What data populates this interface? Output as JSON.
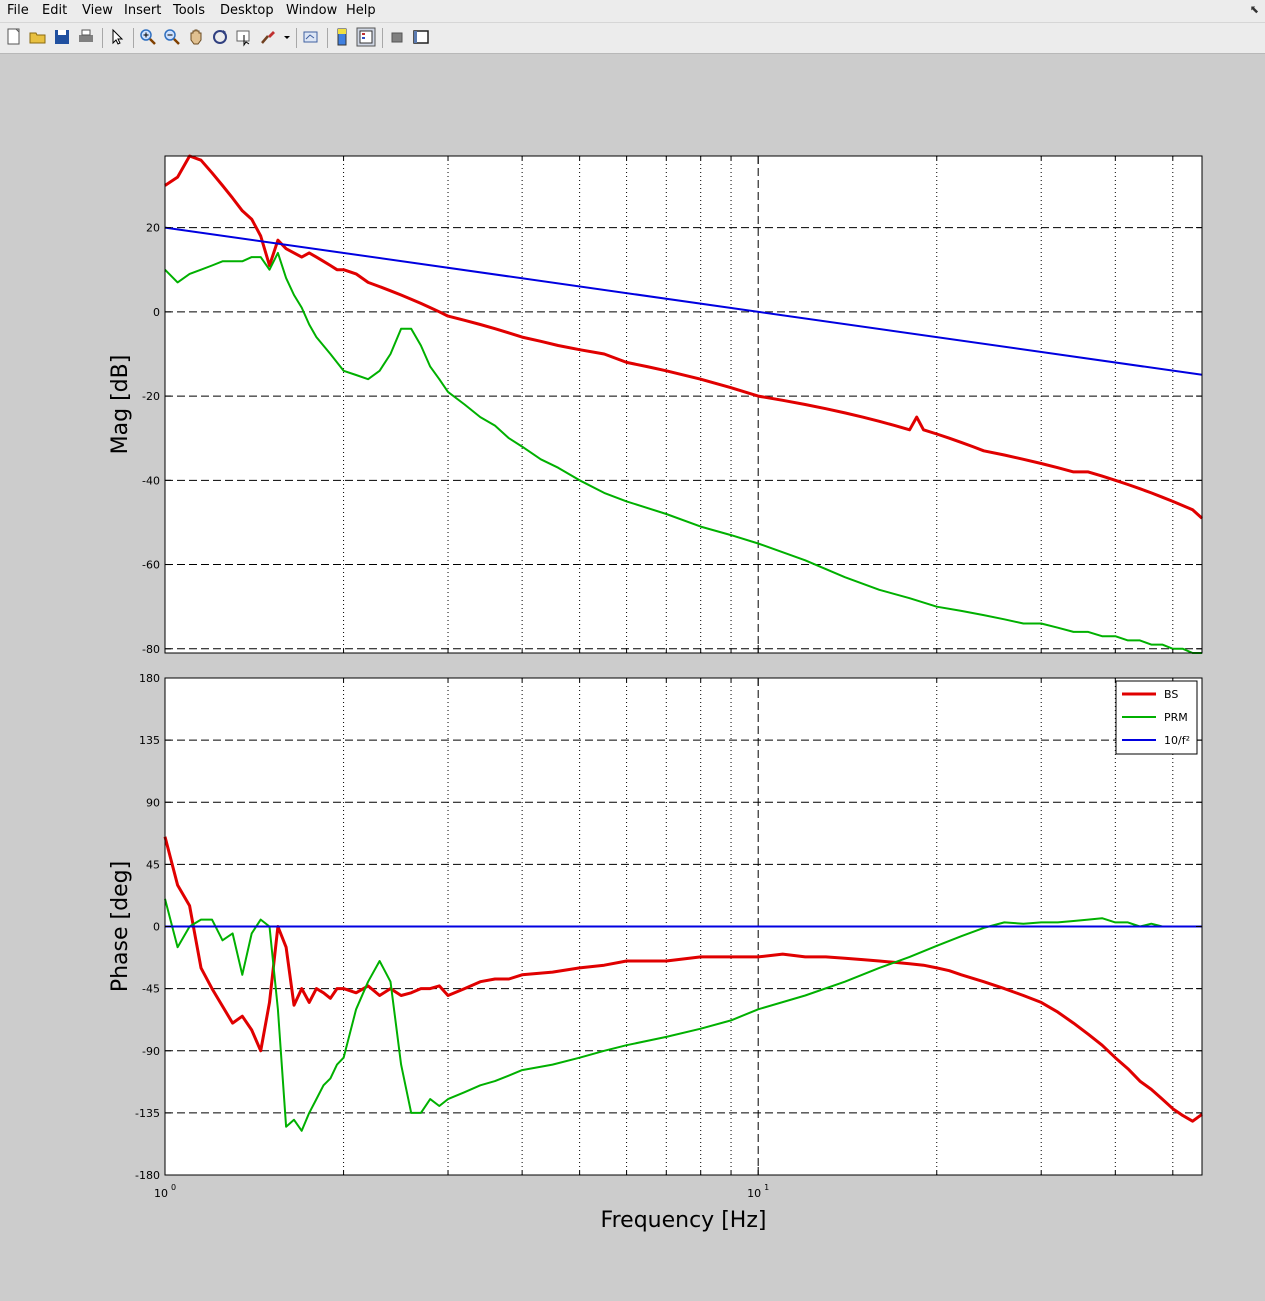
{
  "menu": [
    "File",
    "Edit",
    "View",
    "Insert",
    "Tools",
    "Desktop",
    "Window",
    "Help"
  ],
  "toolbar": [
    {
      "name": "new-figure-icon",
      "color": "#ffffff"
    },
    {
      "name": "open-file-icon",
      "color": "#e8c040"
    },
    {
      "name": "save-icon",
      "color": "#2050a0"
    },
    {
      "name": "print-icon",
      "color": "#808080"
    },
    {
      "sep": true
    },
    {
      "name": "select-arrow-icon",
      "color": "#000000"
    },
    {
      "sep": true
    },
    {
      "name": "zoom-in-icon",
      "color": "#3070c0"
    },
    {
      "name": "zoom-out-icon",
      "color": "#3070c0"
    },
    {
      "name": "pan-hand-icon",
      "color": "#e0c090"
    },
    {
      "name": "rotate-3d-icon",
      "color": "#304080"
    },
    {
      "name": "data-cursor-icon",
      "color": "#606060"
    },
    {
      "name": "brush-icon",
      "color": "#c03030"
    },
    {
      "name": "dropdown-arrow-icon",
      "color": "#000000"
    },
    {
      "sep": true
    },
    {
      "name": "link-plot-icon",
      "color": "#4060a0"
    },
    {
      "sep": true
    },
    {
      "name": "colorbar-icon",
      "color": "#4080e0"
    },
    {
      "name": "legend-icon",
      "color": "#c03030"
    },
    {
      "sep": true
    },
    {
      "name": "hide-plot-tools-icon",
      "color": "#808080"
    },
    {
      "name": "show-plot-tools-icon",
      "color": "#202020"
    }
  ],
  "chart_data": [
    {
      "type": "line",
      "ylabel": "Mag [dB]",
      "xscale": "log",
      "xlim": [
        1,
        56
      ],
      "ylim": [
        -81,
        37
      ],
      "yticks": [
        -80,
        -60,
        -40,
        -20,
        0,
        20
      ],
      "grid": true,
      "series": [
        {
          "name": "BS",
          "color": "#e00000",
          "x": [
            1,
            1.05,
            1.1,
            1.15,
            1.2,
            1.25,
            1.3,
            1.35,
            1.4,
            1.45,
            1.5,
            1.55,
            1.6,
            1.65,
            1.7,
            1.75,
            1.8,
            1.85,
            1.9,
            1.95,
            2,
            2.1,
            2.2,
            2.3,
            2.4,
            2.5,
            2.6,
            2.7,
            2.8,
            2.9,
            3,
            3.2,
            3.4,
            3.6,
            3.8,
            4,
            4.3,
            4.6,
            5,
            5.5,
            6,
            6.5,
            7,
            8,
            9,
            10,
            11,
            12,
            13,
            14,
            15,
            16,
            17,
            18,
            18.5,
            19,
            20,
            21,
            22,
            23,
            24,
            26,
            28,
            30,
            32,
            34,
            36,
            38,
            40,
            42,
            44,
            46,
            48,
            50,
            52,
            54,
            56
          ],
          "y": [
            30,
            32,
            37,
            36,
            33,
            30,
            27,
            24,
            22,
            18,
            11,
            17,
            15,
            14,
            13,
            14,
            13,
            12,
            11,
            10,
            10,
            9,
            7,
            6,
            5,
            4,
            3,
            2,
            1,
            0,
            -1,
            -2,
            -3,
            -4,
            -5,
            -6,
            -7,
            -8,
            -9,
            -10,
            -12,
            -13,
            -14,
            -16,
            -18,
            -20,
            -21,
            -22,
            -23,
            -24,
            -25,
            -26,
            -27,
            -28,
            -25,
            -28,
            -29,
            -30,
            -31,
            -32,
            -33,
            -34,
            -35,
            -36,
            -37,
            -38,
            -38,
            -39,
            -40,
            -41,
            -42,
            -43,
            -44,
            -45,
            -46,
            -47,
            -49
          ]
        },
        {
          "name": "PRM",
          "color": "#00b000",
          "x": [
            1,
            1.05,
            1.1,
            1.15,
            1.2,
            1.25,
            1.3,
            1.35,
            1.4,
            1.45,
            1.5,
            1.55,
            1.6,
            1.65,
            1.7,
            1.75,
            1.8,
            1.9,
            2,
            2.1,
            2.2,
            2.3,
            2.4,
            2.5,
            2.6,
            2.7,
            2.8,
            2.9,
            3,
            3.2,
            3.4,
            3.6,
            3.8,
            4,
            4.3,
            4.6,
            5,
            5.5,
            6,
            7,
            8,
            9,
            10,
            12,
            14,
            16,
            18,
            20,
            22,
            24,
            26,
            28,
            30,
            32,
            34,
            36,
            38,
            40,
            42,
            44,
            46,
            48,
            50,
            52,
            54,
            56
          ],
          "y": [
            10,
            7,
            9,
            10,
            11,
            12,
            12,
            12,
            13,
            13,
            10,
            14,
            8,
            4,
            1,
            -3,
            -6,
            -10,
            -14,
            -15,
            -16,
            -14,
            -10,
            -4,
            -4,
            -8,
            -13,
            -16,
            -19,
            -22,
            -25,
            -27,
            -30,
            -32,
            -35,
            -37,
            -40,
            -43,
            -45,
            -48,
            -51,
            -53,
            -55,
            -59,
            -63,
            -66,
            -68,
            -70,
            -71,
            -72,
            -73,
            -74,
            -74,
            -75,
            -76,
            -76,
            -77,
            -77,
            -78,
            -78,
            -79,
            -79,
            -80,
            -80,
            -81,
            -81
          ]
        },
        {
          "name": "10/f²",
          "color": "#0000e0",
          "x": [
            1,
            56
          ],
          "y": [
            20,
            -14.96
          ]
        }
      ]
    },
    {
      "type": "line",
      "xlabel": "Frequency [Hz]",
      "ylabel": "Phase [deg]",
      "xscale": "log",
      "xlim": [
        1,
        56
      ],
      "ylim": [
        -180,
        180
      ],
      "yticks": [
        -180,
        -135,
        -90,
        -45,
        0,
        45,
        90,
        135,
        180
      ],
      "xticklabels": [
        {
          "base": "10",
          "exp": "0"
        },
        {
          "base": "10",
          "exp": "1"
        }
      ],
      "grid": true,
      "legend": "top-right",
      "series": [
        {
          "name": "BS",
          "color": "#e00000",
          "x": [
            1,
            1.05,
            1.1,
            1.15,
            1.2,
            1.3,
            1.35,
            1.4,
            1.45,
            1.5,
            1.55,
            1.6,
            1.65,
            1.7,
            1.75,
            1.8,
            1.85,
            1.9,
            1.95,
            2,
            2.1,
            2.2,
            2.3,
            2.4,
            2.5,
            2.6,
            2.7,
            2.8,
            2.9,
            3,
            3.2,
            3.4,
            3.6,
            3.8,
            4,
            4.5,
            5,
            5.5,
            6,
            6.5,
            7,
            8,
            9,
            10,
            11,
            12,
            13,
            14,
            15,
            16,
            17,
            18,
            19,
            20,
            21,
            22,
            24,
            26,
            28,
            30,
            32,
            34,
            36,
            38,
            40,
            42,
            44,
            46,
            48,
            50,
            52,
            54,
            56
          ],
          "y": [
            65,
            30,
            15,
            -30,
            -45,
            -70,
            -65,
            -75,
            -90,
            -55,
            0,
            -15,
            -57,
            -45,
            -55,
            -45,
            -48,
            -52,
            -45,
            -45,
            -48,
            -43,
            -50,
            -45,
            -50,
            -48,
            -45,
            -45,
            -43,
            -50,
            -45,
            -40,
            -38,
            -38,
            -35,
            -33,
            -30,
            -28,
            -25,
            -25,
            -25,
            -22,
            -22,
            -22,
            -20,
            -22,
            -22,
            -23,
            -24,
            -25,
            -26,
            -27,
            -28,
            -30,
            -32,
            -35,
            -40,
            -45,
            -50,
            -55,
            -62,
            -70,
            -78,
            -86,
            -95,
            -103,
            -112,
            -118,
            -125,
            -132,
            -137,
            -141,
            -136
          ]
        },
        {
          "name": "PRM",
          "color": "#00b000",
          "x": [
            1,
            1.05,
            1.1,
            1.15,
            1.2,
            1.25,
            1.3,
            1.35,
            1.4,
            1.45,
            1.5,
            1.55,
            1.6,
            1.65,
            1.7,
            1.75,
            1.8,
            1.85,
            1.9,
            1.95,
            2,
            2.1,
            2.2,
            2.3,
            2.4,
            2.5,
            2.6,
            2.7,
            2.8,
            2.9,
            3,
            3.2,
            3.4,
            3.6,
            3.8,
            4,
            4.5,
            5,
            5.5,
            6,
            7,
            8,
            9,
            10,
            12,
            14,
            16,
            18,
            20,
            22,
            24,
            26,
            28,
            30,
            32,
            34,
            36,
            38,
            40,
            42,
            44,
            46,
            48,
            50,
            52,
            54,
            56
          ],
          "y": [
            20,
            -15,
            0,
            5,
            5,
            -10,
            -5,
            -35,
            -5,
            5,
            0,
            -60,
            -145,
            -140,
            -148,
            -135,
            -125,
            -115,
            -110,
            -100,
            -95,
            -60,
            -40,
            -25,
            -40,
            -100,
            -135,
            -135,
            -125,
            -130,
            -125,
            -120,
            -115,
            -112,
            -108,
            -104,
            -100,
            -95,
            -90,
            -86,
            -80,
            -74,
            -68,
            -60,
            -50,
            -40,
            -30,
            -22,
            -14,
            -7,
            -1,
            3,
            2,
            3,
            3,
            4,
            5,
            6,
            3,
            3,
            0,
            2,
            0,
            0,
            0,
            0,
            0
          ]
        },
        {
          "name": "10/f²",
          "color": "#0000e0",
          "x": [
            1,
            56
          ],
          "y": [
            0,
            0
          ]
        }
      ]
    }
  ]
}
